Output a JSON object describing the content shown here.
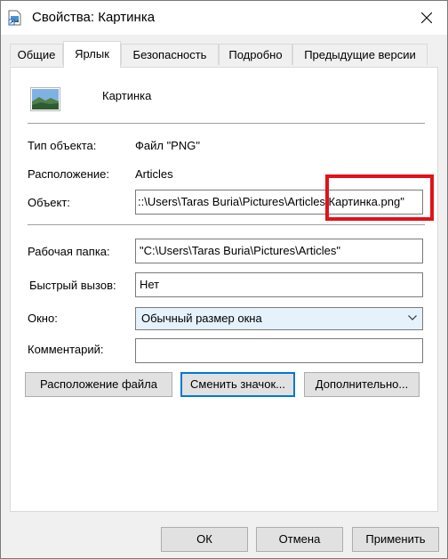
{
  "window": {
    "title": "Свойства: Картинка"
  },
  "tabs": [
    {
      "label": "Общие",
      "active": false
    },
    {
      "label": "Ярлык",
      "active": true
    },
    {
      "label": "Безопасность",
      "active": false
    },
    {
      "label": "Подробно",
      "active": false
    },
    {
      "label": "Предыдущие версии",
      "active": false
    }
  ],
  "shortcut": {
    "name": "Картинка",
    "type_label": "Тип объекта:",
    "type_value": "Файл \"PNG\"",
    "location_label": "Расположение:",
    "location_value": "Articles",
    "target_label": "Объект:",
    "target_value": "::\\Users\\Taras Buria\\Pictures\\Articles\\Картинка.png\"",
    "start_in_label": "Рабочая папка:",
    "start_in_value": "\"C:\\Users\\Taras Buria\\Pictures\\Articles\"",
    "hotkey_label": "Быстрый вызов:",
    "hotkey_value": "Нет",
    "run_label": "Окно:",
    "run_value": "Обычный размер окна",
    "comment_label": "Комментарий:",
    "comment_value": ""
  },
  "actions": {
    "open_location": "Расположение файла",
    "change_icon": "Сменить значок...",
    "advanced": "Дополнительно..."
  },
  "footer": {
    "ok": "ОК",
    "cancel": "Отмена",
    "apply": "Применить"
  },
  "colors": {
    "highlight": "#e0121a",
    "focus": "#0078d7",
    "dropdown_bg": "#e5f1fb"
  },
  "icons": {
    "title": "shortcut-image-icon",
    "file": "image-thumbnail-icon",
    "close": "close-icon",
    "dropdown": "chevron-down-icon"
  }
}
